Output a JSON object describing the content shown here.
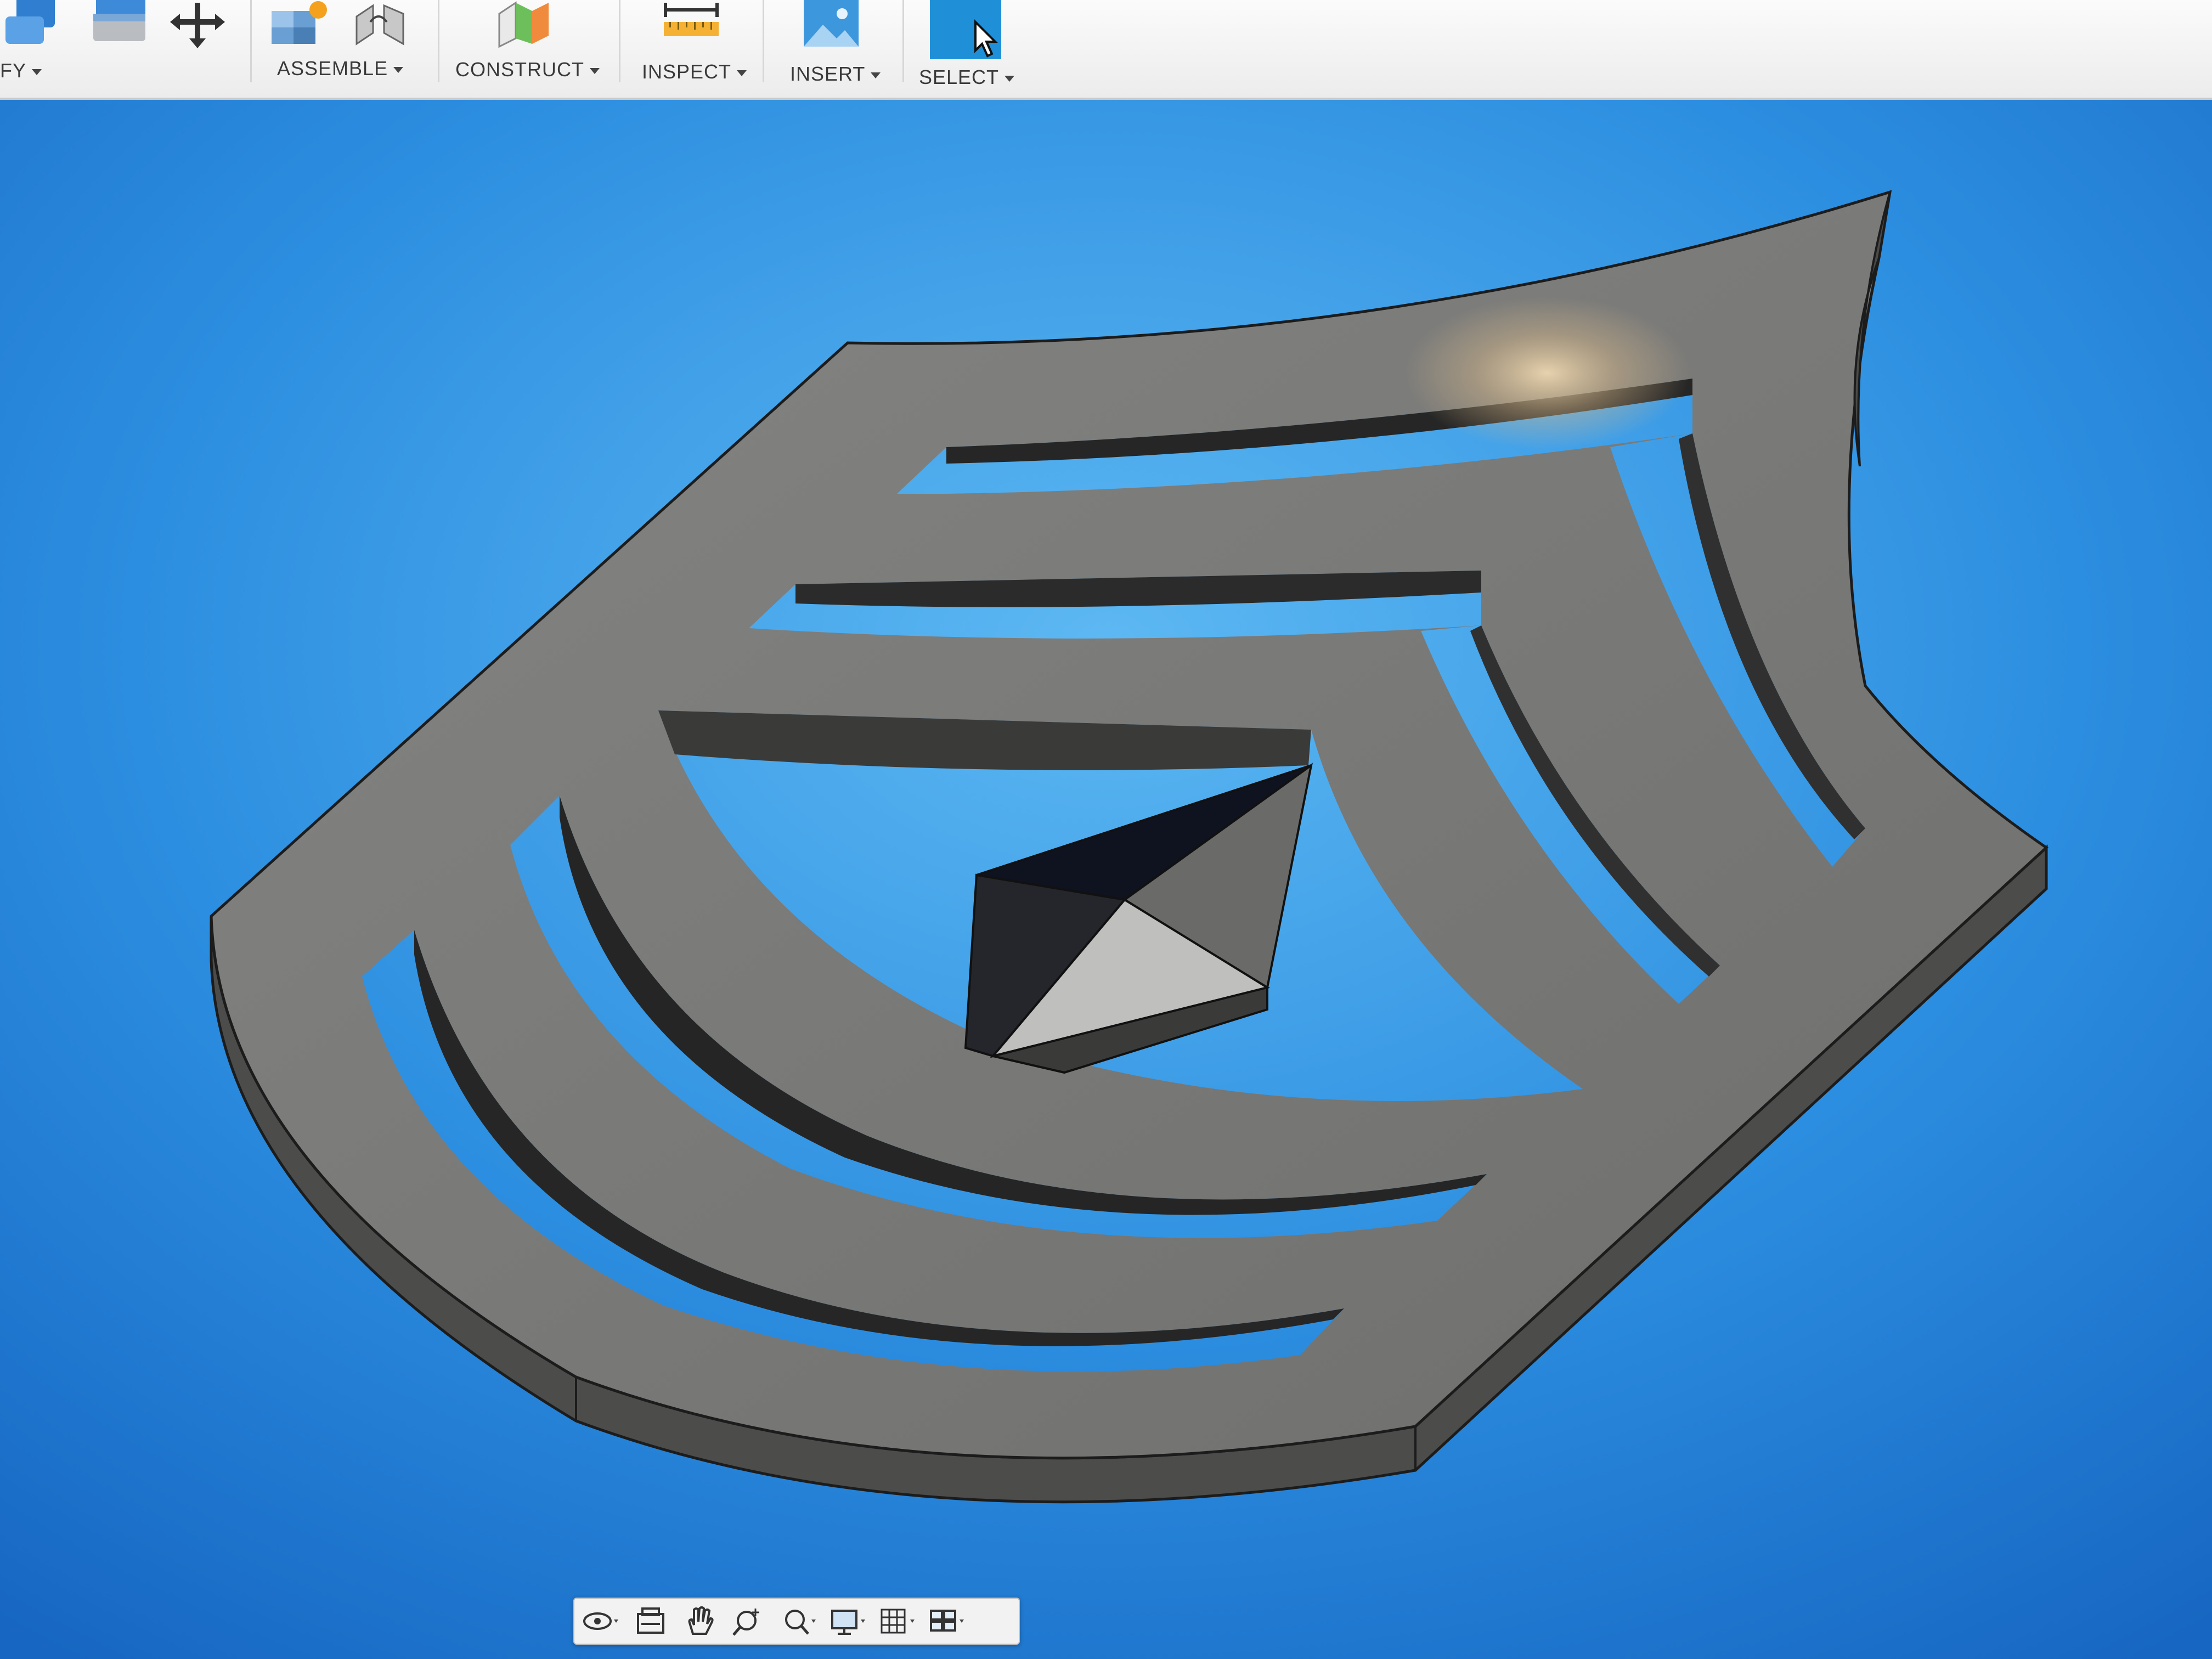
{
  "toolbar": {
    "groups": [
      {
        "id": "modify",
        "label": "FY",
        "icon": "modify-icon"
      },
      {
        "id": "assemble",
        "label": "ASSEMBLE",
        "icon": "assemble-icon"
      },
      {
        "id": "construct",
        "label": "CONSTRUCT",
        "icon": "construct-plane-icon"
      },
      {
        "id": "inspect",
        "label": "INSPECT",
        "icon": "measure-icon"
      },
      {
        "id": "insert",
        "label": "INSERT",
        "icon": "insert-image-icon"
      },
      {
        "id": "select",
        "label": "SELECT",
        "icon": "select-cursor-icon"
      }
    ]
  },
  "viewport": {
    "model": "military-rank-insignia-body",
    "background_color": "#1d7fd8",
    "model_color": "#7a7a78"
  },
  "navigation_bar": {
    "buttons": [
      {
        "icon": "orbit-icon",
        "has_dropdown": true
      },
      {
        "icon": "look-at-icon",
        "has_dropdown": false
      },
      {
        "icon": "pan-hand-icon",
        "has_dropdown": false
      },
      {
        "icon": "zoom-icon",
        "has_dropdown": false
      },
      {
        "icon": "zoom-window-icon",
        "has_dropdown": true
      },
      {
        "icon": "display-settings-icon",
        "has_dropdown": true
      },
      {
        "icon": "grid-icon",
        "has_dropdown": true
      },
      {
        "icon": "viewports-icon",
        "has_dropdown": true
      }
    ]
  }
}
